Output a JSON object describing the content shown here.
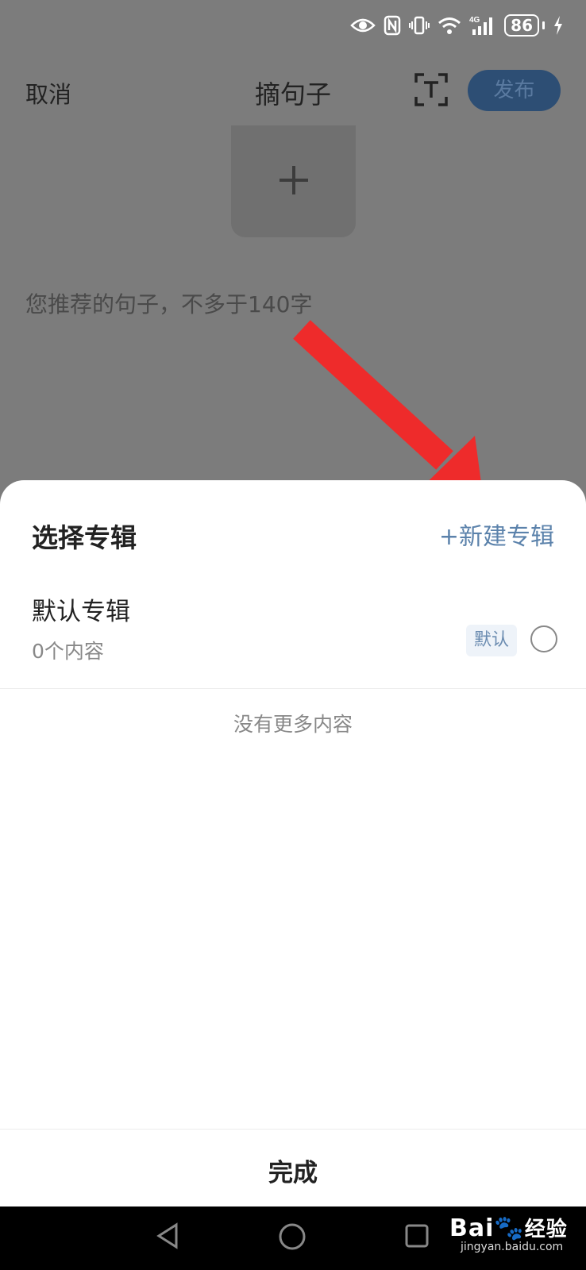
{
  "statusbar": {
    "battery_level": "86",
    "icons": [
      "eye-icon",
      "nfc-icon",
      "vibrate-icon",
      "wifi-icon",
      "signal-4g-icon",
      "battery-icon",
      "charging-icon"
    ]
  },
  "topbar": {
    "cancel_label": "取消",
    "title": "摘句子",
    "publish_label": "发布"
  },
  "composer": {
    "placeholder": "您推荐的句子，不多于140字"
  },
  "sheet": {
    "title": "选择专辑",
    "new_album_label": "+新建专辑",
    "albums": [
      {
        "name": "默认专辑",
        "count": "0个内容",
        "badge": "默认",
        "selected": false
      }
    ],
    "no_more_text": "没有更多内容",
    "done_label": "完成"
  },
  "navbar": {
    "watermark_brand": "Bai",
    "watermark_brand_suffix": "经验",
    "watermark_url": "jingyan.baidu.com"
  },
  "colors": {
    "overlay": "#7c7c7c",
    "accent_blue": "#5b82ab",
    "arrow_red": "#ee2b2b"
  }
}
